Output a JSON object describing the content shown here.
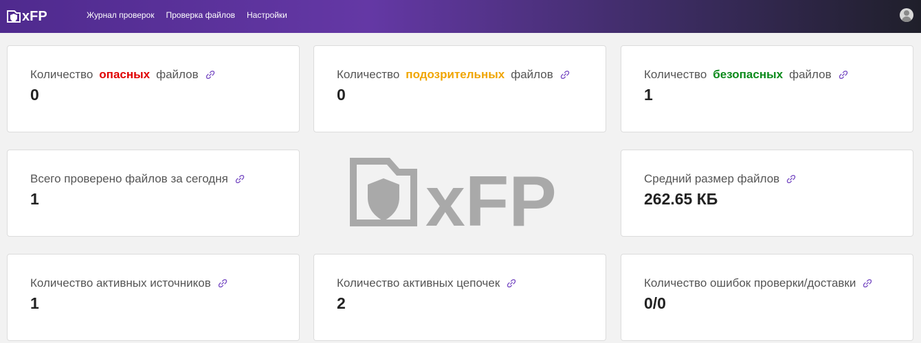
{
  "brand": {
    "name": "xFP"
  },
  "nav": [
    {
      "label": "Журнал проверок"
    },
    {
      "label": "Проверка файлов"
    },
    {
      "label": "Настройки"
    }
  ],
  "watermark": {
    "text": "xFP"
  },
  "colors": {
    "danger": "#e00000",
    "suspicious": "#f0a500",
    "safe": "#0b8a1b",
    "link_icon": "#7a4fc4"
  },
  "cards": {
    "dangerous": {
      "prefix": "Количество",
      "highlight": "опасных",
      "suffix": "файлов",
      "value": "0"
    },
    "suspicious": {
      "prefix": "Количество",
      "highlight": "подозрительных",
      "suffix": "файлов",
      "value": "0"
    },
    "safe": {
      "prefix": "Количество",
      "highlight": "безопасных",
      "suffix": "файлов",
      "value": "1"
    },
    "today": {
      "title": "Всего проверено файлов за сегодня",
      "value": "1"
    },
    "avg_size": {
      "title": "Средний размер файлов",
      "value": "262.65 КБ"
    },
    "sources": {
      "title": "Количество активных источников",
      "value": "1"
    },
    "chains": {
      "title": "Количество активных цепочек",
      "value": "2"
    },
    "errors": {
      "title": "Количество ошибок проверки/доставки",
      "value": "0/0"
    }
  }
}
